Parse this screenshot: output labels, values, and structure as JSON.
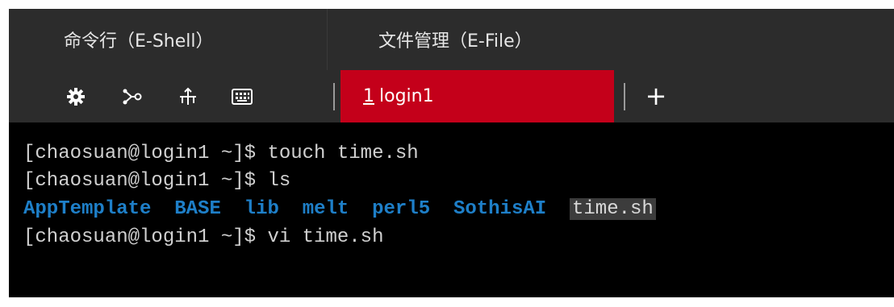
{
  "top_tabs": [
    {
      "label": "命令行（E-Shell）"
    },
    {
      "label": "文件管理（E-File）"
    }
  ],
  "toolbar": {
    "icons": [
      "gear-icon",
      "share-icon",
      "transfer-icon",
      "keyboard-icon"
    ],
    "session_tab": {
      "number": "1",
      "name": "login1"
    },
    "add_label": "+"
  },
  "terminal": {
    "lines": [
      "[chaosuan@login1 ~]$ touch time.sh",
      "[chaosuan@login1 ~]$ ls",
      "[chaosuan@login1 ~]$ vi time.sh"
    ],
    "ls_dirs": [
      "AppTemplate",
      "BASE",
      "lib",
      "melt",
      "perl5",
      "SothisAI"
    ],
    "ls_file": "time.sh"
  },
  "colors": {
    "active_tab": "#c4001a",
    "dir_text": "#1e7fc8",
    "toolbar_bg": "#2c2c2c"
  }
}
